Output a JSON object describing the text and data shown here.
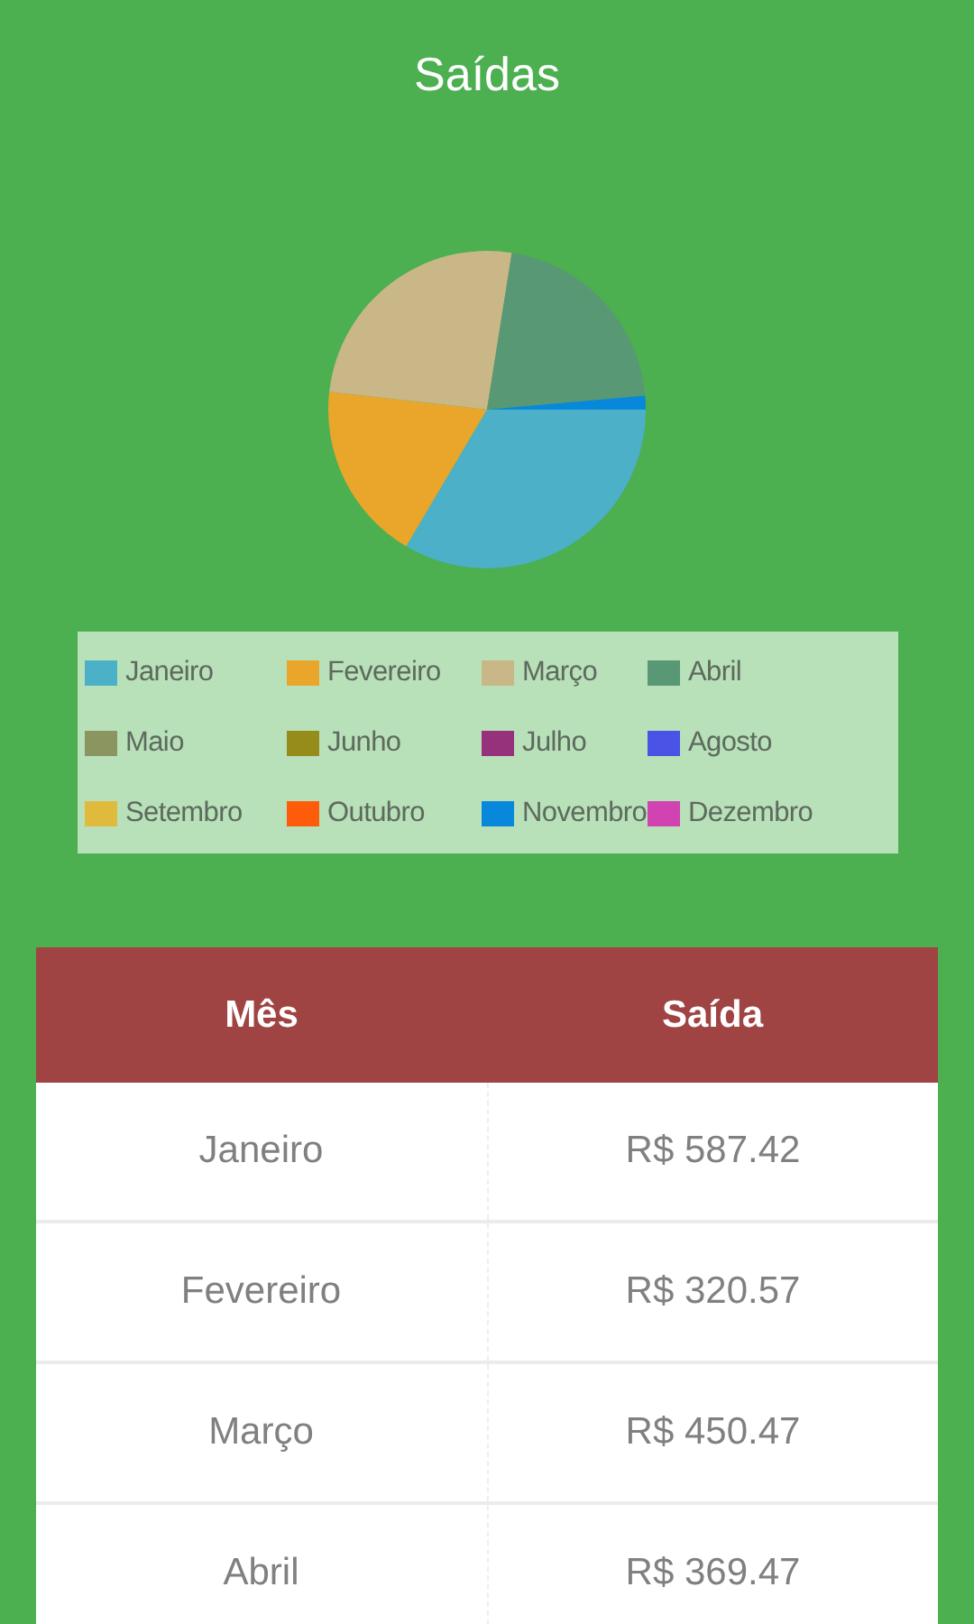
{
  "title": "Saídas",
  "chart_data": {
    "type": "pie",
    "categories": [
      "Janeiro",
      "Fevereiro",
      "Março",
      "Abril",
      "Maio",
      "Junho",
      "Julho",
      "Agosto",
      "Setembro",
      "Outubro",
      "Novembro",
      "Dezembro"
    ],
    "values": [
      33.5,
      18.3,
      25.7,
      21.1,
      0,
      0,
      0,
      0,
      0,
      0,
      1.4,
      0
    ],
    "colors": [
      "#4bb0c8",
      "#e9a62b",
      "#c9b787",
      "#589875",
      "#8a9560",
      "#958c1c",
      "#96317c",
      "#4b53e6",
      "#e0ba3c",
      "#fe5b0b",
      "#0788da",
      "#d043b0"
    ]
  },
  "table": {
    "columns": [
      "Mês",
      "Saída"
    ],
    "rows": [
      [
        "Janeiro",
        "R$ 587.42"
      ],
      [
        "Fevereiro",
        "R$ 320.57"
      ],
      [
        "Março",
        "R$ 450.47"
      ],
      [
        "Abril",
        "R$ 369.47"
      ]
    ]
  }
}
